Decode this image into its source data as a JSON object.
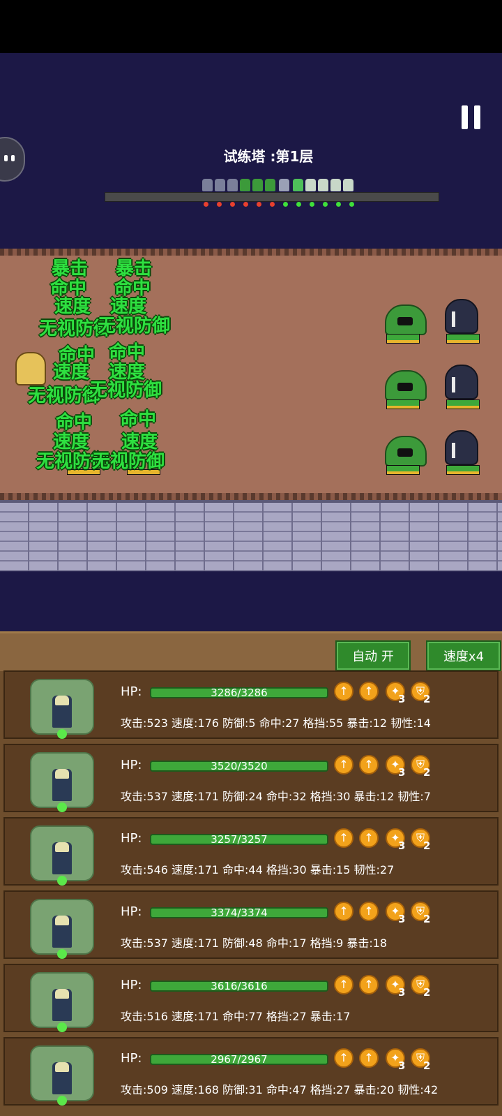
{
  "stage_title": "试练塔 :第1层",
  "battle_floats": {
    "crit": "暴击",
    "hit": "命中",
    "speed": "速度",
    "ignore_def": "无视防御"
  },
  "controls": {
    "auto_label": "自动 开",
    "speed_label": "速度x4"
  },
  "units": [
    {
      "hp": "3286/3286",
      "hp_fraction": 1.0,
      "stats": "攻击:523 速度:176 防御:5 命中:27 格挡:55 暴击:12 韧性:14",
      "buff3_count": "3",
      "buff4_count": "2"
    },
    {
      "hp": "3520/3520",
      "hp_fraction": 1.0,
      "stats": "攻击:537 速度:171 防御:24 命中:32 格挡:30 暴击:12 韧性:7",
      "buff3_count": "3",
      "buff4_count": "2"
    },
    {
      "hp": "3257/3257",
      "hp_fraction": 1.0,
      "stats": "攻击:546 速度:171 命中:44 格挡:30 暴击:15 韧性:27",
      "buff3_count": "3",
      "buff4_count": "2"
    },
    {
      "hp": "3374/3374",
      "hp_fraction": 1.0,
      "stats": "攻击:537 速度:171 防御:48 命中:17 格挡:9 暴击:18",
      "buff3_count": "3",
      "buff4_count": "2"
    },
    {
      "hp": "3616/3616",
      "hp_fraction": 1.0,
      "stats": "攻击:516 速度:171 命中:77 格挡:27 暴击:17",
      "buff3_count": "3",
      "buff4_count": "2"
    },
    {
      "hp": "2967/2967",
      "hp_fraction": 1.0,
      "stats": "攻击:509 速度:168 防御:31 命中:47 格挡:27 暴击:20 韧性:42",
      "buff3_count": "3",
      "buff4_count": "2"
    }
  ],
  "icons": {
    "pause": "pause-icon",
    "chat": "chat-bubble-icon",
    "buff_attack": "arrow-up-icon",
    "buff_speed": "arrow-up-icon",
    "buff_wing": "wing-icon",
    "buff_shield": "shield-icon"
  },
  "colors": {
    "sky": "#1c1846",
    "floor": "#a4705b",
    "hp_green": "#3ea83a",
    "float_green": "#2ee040",
    "button_green": "#2f8a2b",
    "panel_brown": "#6e4e2d"
  }
}
